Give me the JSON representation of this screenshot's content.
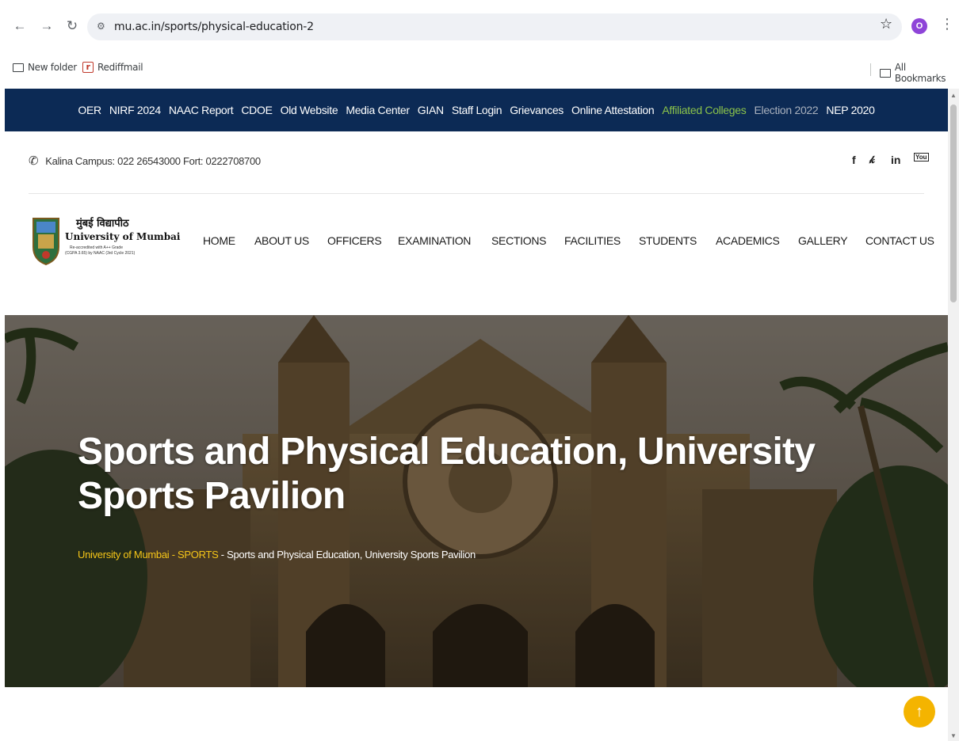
{
  "browser": {
    "url": "mu.ac.in/sports/physical-education-2",
    "profile_initial": "O",
    "bookmarks": [
      {
        "label": "New folder",
        "icon": "folder-icon"
      },
      {
        "label": "Rediffmail",
        "icon": "rediffmail-icon"
      }
    ],
    "all_bookmarks_label": "All Bookmarks"
  },
  "topnav": {
    "items": [
      {
        "label": "OER",
        "style": "white"
      },
      {
        "label": "NIRF 2024",
        "style": "white"
      },
      {
        "label": "NAAC Report",
        "style": "white"
      },
      {
        "label": "CDOE",
        "style": "white"
      },
      {
        "label": "Old Website",
        "style": "white"
      },
      {
        "label": "Media Center",
        "style": "white"
      },
      {
        "label": "GIAN",
        "style": "white"
      },
      {
        "label": "Staff Login",
        "style": "white"
      },
      {
        "label": "Grievances",
        "style": "white"
      },
      {
        "label": "Online Attestation",
        "style": "white"
      },
      {
        "label": "Affiliated Colleges",
        "style": "green"
      },
      {
        "label": "Election 2022",
        "style": "gray"
      },
      {
        "label": "NEP 2020",
        "style": "white"
      }
    ],
    "background": "#0c2a55"
  },
  "contact": {
    "text": "Kalina Campus: 022 26543000 Fort: 0222708700"
  },
  "social": {
    "facebook": "f",
    "twitter": "𝕐",
    "linkedin": "in",
    "youtube": "You"
  },
  "logo": {
    "hindi": "मुंबई विद्यापीठ",
    "english": "University of Mumbai",
    "sub1": "Re-accredited with A++ Grade",
    "sub2": "(CGPA 3.65) by NAAC (3rd Cycle 2021)"
  },
  "mainnav": {
    "items": [
      "HOME",
      "ABOUT US",
      "OFFICERS",
      "EXAMINATION",
      "SECTIONS",
      "FACILITIES",
      "STUDENTS",
      "ACADEMICS",
      "GALLERY",
      "CONTACT US"
    ]
  },
  "hero": {
    "title": "Sports and Physical Education, University Sports Pavilion",
    "breadcrumb": {
      "home": "University of Mumbai",
      "section": "SPORTS",
      "current": "Sports and Physical Education, University Sports Pavilion"
    }
  },
  "colors": {
    "accent_yellow": "#f5c518",
    "back_to_top": "#f4b400"
  }
}
